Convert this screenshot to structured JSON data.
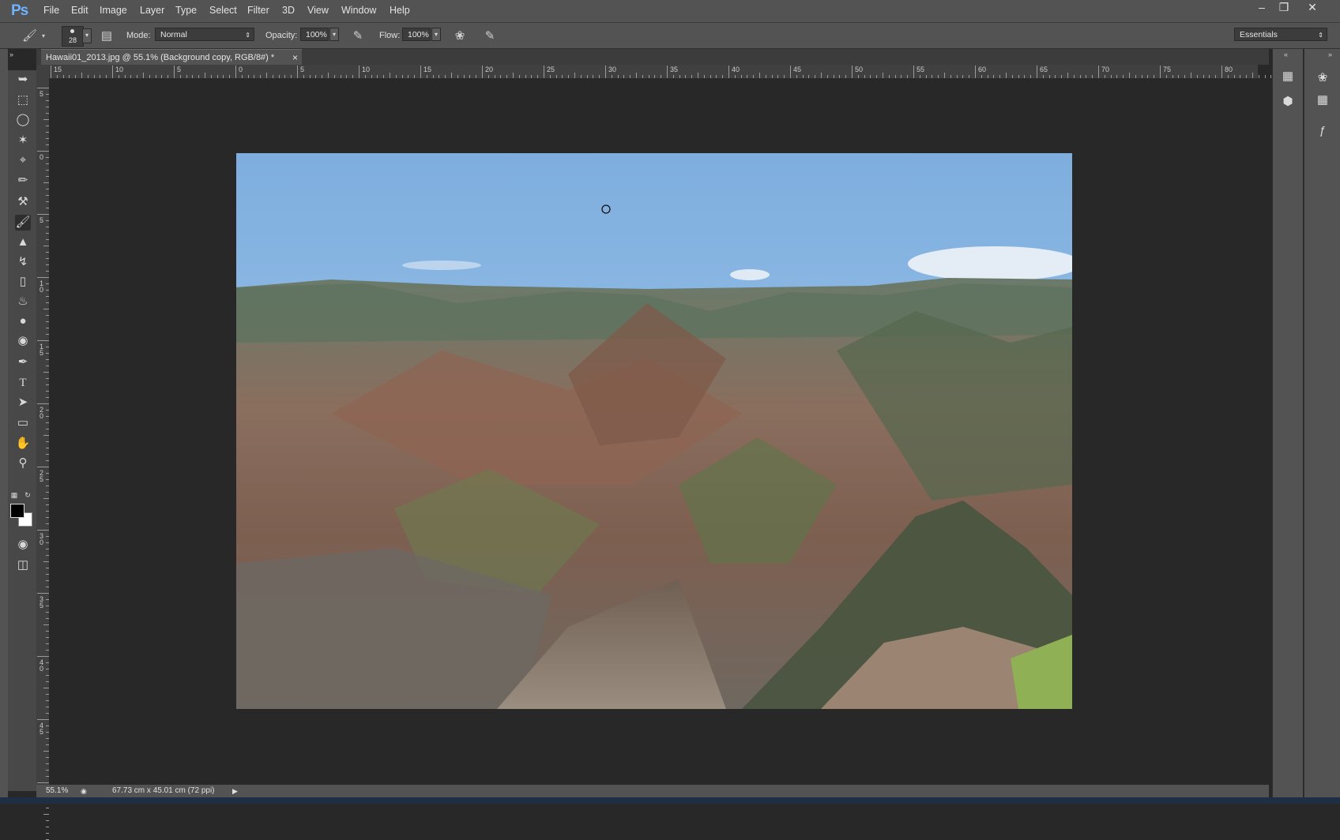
{
  "app": {
    "logo": "Ps",
    "menu": [
      "File",
      "Edit",
      "Image",
      "Layer",
      "Type",
      "Select",
      "Filter",
      "3D",
      "View",
      "Window",
      "Help"
    ]
  },
  "window_controls": {
    "minimize": "–",
    "restore": "❐",
    "close": "✕"
  },
  "options_bar": {
    "brush_size": "28",
    "mode_label": "Mode:",
    "mode_value": "Normal",
    "opacity_label": "Opacity:",
    "opacity_value": "100%",
    "flow_label": "Flow:",
    "flow_value": "100%",
    "workspace": "Essentials"
  },
  "document": {
    "tab_title": "Hawaii01_2013.jpg @ 55.1% (Background copy, RGB/8#) *",
    "close": "×"
  },
  "ruler_h": [
    "15",
    "10",
    "5",
    "0",
    "5",
    "10",
    "15",
    "20",
    "25",
    "30",
    "35",
    "40",
    "45",
    "50",
    "55",
    "60",
    "65",
    "70",
    "75",
    "80"
  ],
  "ruler_v": [
    "5",
    "0",
    "5",
    "1 0",
    "1 5",
    "2 0",
    "2 5",
    "3 0",
    "3 5",
    "4 0",
    "4 5",
    "5 0"
  ],
  "status": {
    "zoom": "55.1%",
    "doc_size": "67.73 cm x 45.01 cm (72 ppi)"
  },
  "colors": {
    "ui_panel": "#535353",
    "canvas_bg": "#282828",
    "ps_blue": "#6fb3ff"
  }
}
